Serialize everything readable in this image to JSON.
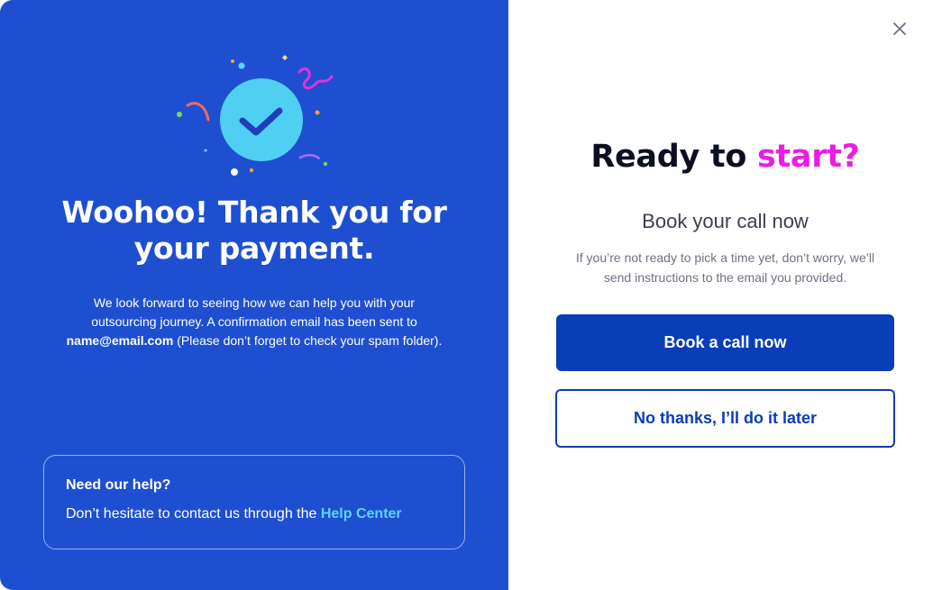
{
  "colors": {
    "left_background": "#1f4fd1",
    "primary_button": "#0a3db8",
    "accent_magenta": "#ea1de4",
    "link_cyan": "#5fd3f3",
    "check_circle": "#4fd0f2"
  },
  "left_panel": {
    "illustration_icon": "check-circle-confetti-icon",
    "headline_line1": "Woohoo! Thank you for",
    "headline_line2": "your payment.",
    "body_line1": "We look forward to seeing how we can help you with your",
    "body_line2": "outsourcing journey. A confirmation email has been sent to",
    "email": "name@email.com",
    "body_line3_rest": " (Please don’t forget to check your spam folder).",
    "help": {
      "title": "Need our help?",
      "text": "Don’t hesitate to contact us through the ",
      "link": "Help Center"
    }
  },
  "right_panel": {
    "close_icon": "close-icon",
    "title_main": "Ready to ",
    "title_accent": "start?",
    "subtitle": "Book your call now",
    "info_line1": "If you’re not ready to pick a time yet, don’t worry, we’ll",
    "info_line2": "send instructions to the email you provided.",
    "primary_button": "Book a call now",
    "secondary_button": "No thanks, I’ll do it later"
  }
}
